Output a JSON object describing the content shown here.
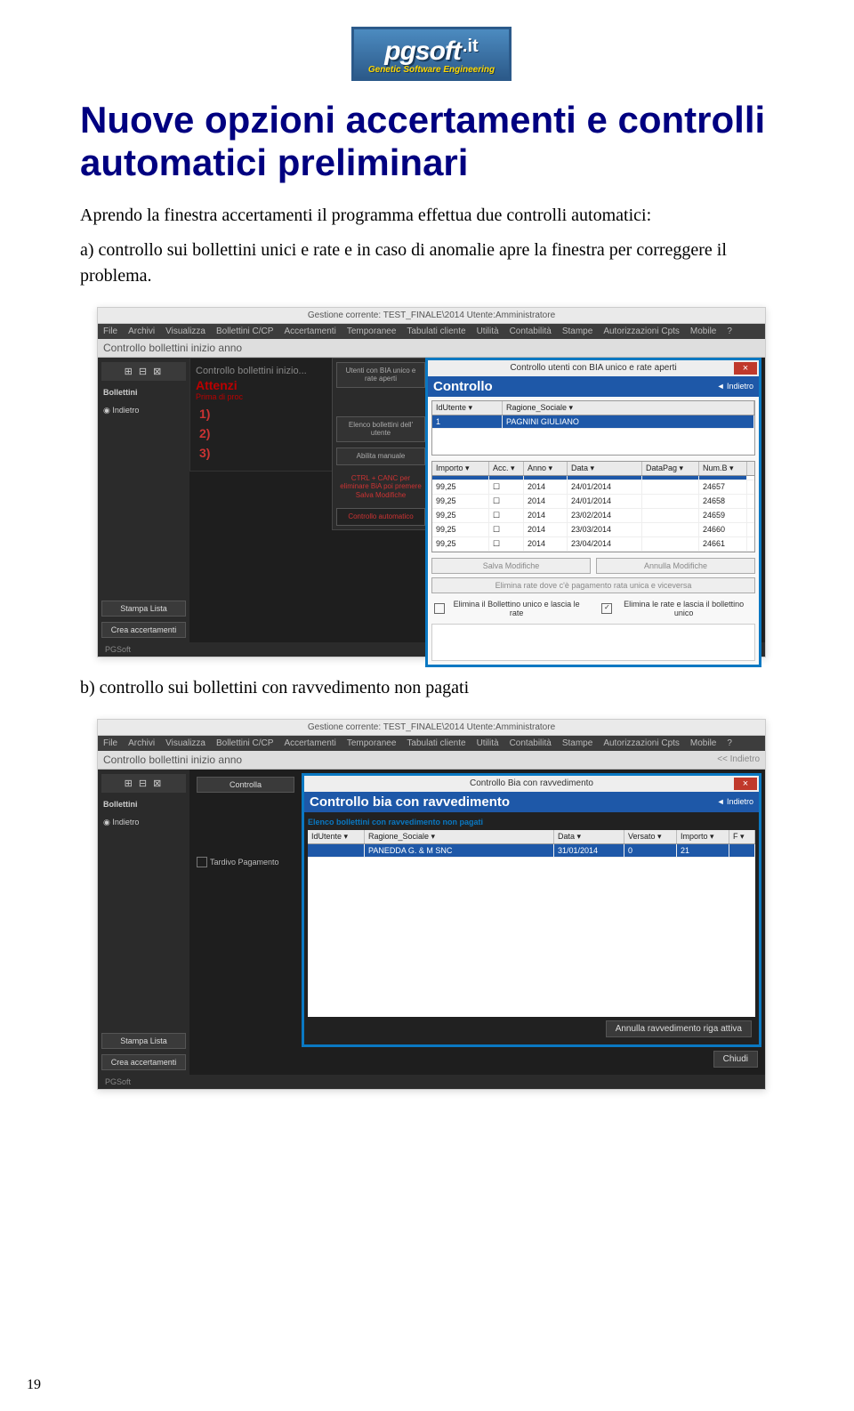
{
  "logo": {
    "main": "pgsoft",
    "suffix": ".it",
    "tagline": "Genetic Software Engineering"
  },
  "heading": "Nuove opzioni accertamenti e controlli automatici preliminari",
  "intro": "Aprendo la finestra accertamenti il programma effettua due controlli automatici:",
  "point_a": "a) controllo sui bollettini unici e rate e in caso di anomalie apre la finestra per correggere il problema.",
  "point_b": "b) controllo sui bollettini con ravvedimento non pagati",
  "page_number": "19",
  "app": {
    "title": "Gestione corrente: TEST_FINALE\\2014 Utente:Amministratore",
    "menu": [
      "File",
      "Archivi",
      "Visualizza",
      "Bollettini C/CP",
      "Accertamenti",
      "Temporanee",
      "Tabulati cliente",
      "Utilità",
      "Contabilità",
      "Stampe",
      "Autorizzazioni Cpts",
      "Mobile",
      "?"
    ],
    "toolstrip_a": "Controllo bollettini inizio anno",
    "toolstrip_b": "Controllo bollettini inizio anno",
    "indietro_link": "<< Indietro",
    "sidebar": {
      "section": "Bollettini",
      "indietro": "Indietro",
      "stampa": "Stampa Lista",
      "crea": "Crea accertamenti"
    },
    "status": "PGSoft"
  },
  "stack_back": {
    "header": "Attenzi",
    "sub": "Prima di proc",
    "n1": "1)",
    "n2": "2)",
    "n3": "3)"
  },
  "mid_panel": {
    "btn1": "Utenti con BIA unico e rate aperti",
    "btn2": "Elenco bollettini dell' utente",
    "btn3": "Abilita manuale",
    "hint": "CTRL + CANC per eliminare BiA poi premere Salva Modifiche",
    "btn4": "Controllo automatico"
  },
  "dialog_a": {
    "outer_title": "Controllo utenti con BIA unico e rate aperti",
    "close": "×",
    "header": "Controllo",
    "indietro": "◄ Indietro",
    "upper_grid": {
      "headers": [
        "IdUtente",
        "Ragione_Sociale"
      ],
      "cw": [
        "70px",
        "auto"
      ],
      "rows": [
        [
          "1",
          "PAGNINI GIULIANO"
        ]
      ]
    },
    "lower_grid": {
      "headers": [
        "Importo",
        "Acc.",
        "Anno",
        "Data",
        "DataPag",
        "Num.B"
      ],
      "cw": [
        "55px",
        "30px",
        "40px",
        "75px",
        "55px",
        "45px"
      ],
      "rows": [
        [
          "",
          "",
          "",
          "",
          "",
          ""
        ],
        [
          "99,25",
          "☐",
          "2014",
          "24/01/2014",
          "",
          "24657"
        ],
        [
          "99,25",
          "☐",
          "2014",
          "24/01/2014",
          "",
          "24658"
        ],
        [
          "99,25",
          "☐",
          "2014",
          "23/02/2014",
          "",
          "24659"
        ],
        [
          "99,25",
          "☐",
          "2014",
          "23/03/2014",
          "",
          "24660"
        ],
        [
          "99,25",
          "☐",
          "2014",
          "23/04/2014",
          "",
          "24661"
        ]
      ],
      "selected_index": 0
    },
    "btn_salva": "Salva Modifiche",
    "btn_annulla": "Annulla Modifiche",
    "btn_elimina": "Elimina rate dove c'è pagamento rata unica e viceversa",
    "chk1_label": "Elimina il Bollettino unico e lascia le rate",
    "chk1_checked": false,
    "chk2_label": "Elimina le rate e lascia il bollettino unico",
    "chk2_checked": true
  },
  "dialog_b": {
    "outer_title": "Controllo Bia con ravvedimento",
    "close": "×",
    "header": "Controllo bia con ravvedimento",
    "indietro": "◄ Indietro",
    "hint": "Elenco bollettini con ravvedimento non pagati",
    "grid": {
      "headers": [
        "IdUtente",
        "Ragione_Sociale",
        "Data",
        "Versato",
        "Importo",
        "F"
      ],
      "cw": [
        "55px",
        "auto",
        "70px",
        "50px",
        "50px",
        "20px"
      ],
      "rows": [
        [
          "",
          "PANEDDA G. & M SNC",
          "31/01/2014",
          "0",
          "21",
          ""
        ]
      ]
    },
    "btn_annulla_ravv": "Annulla ravvedimento riga attiva",
    "btn_chiudi": "Chiudi"
  },
  "sidebar_b": {
    "controlla": "Controlla",
    "tardivo": "Tardivo Pagamento"
  }
}
